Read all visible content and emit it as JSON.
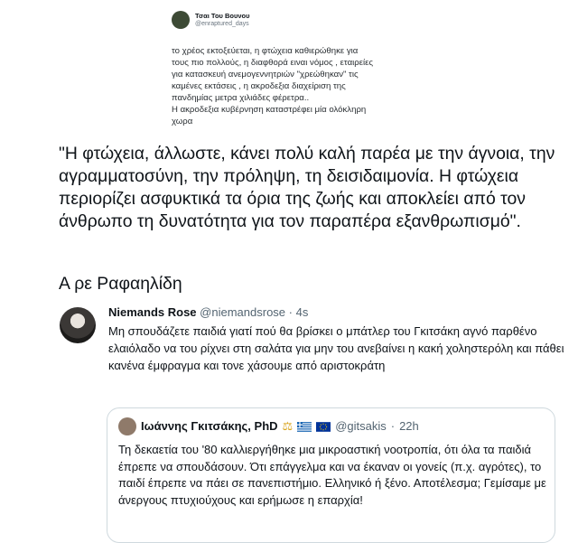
{
  "top_tweet": {
    "name": "Τσαι Του Βουνου",
    "handle": "@enraptured_days",
    "text": "το χρέος εκτοξεύεται, η φτώχεια καθιερώθηκε για\nτους πιο πολλούς, η διαφθορά ειναι νόμος , εταιρείες\nγια κατασκευή ανεμογεννητριών  \"χρεώθηκαν\" τις\nκαμένες εκτάσεις , η ακροδεξια διαχείριση της\nπανδημίας μετρα χιλιάδες φέρετρα..\nΗ ακροδεξια κυβέρνηση καταστρέφει μία ολόκληρη\nχωρα"
  },
  "quote_text": "\"Η φτώχεια, άλλωστε, κάνει πολύ καλή παρέα με την άγνοια, την αγραμματοσύνη, την πρόληψη, τη δεισιδαιμονία. Η φτώχεια περιορίζει ασφυκτικά τα όρια της ζωής και αποκλείει από τον άνθρωπο τη δυνατότητα για τον παραπέρα εξανθρωπισμό\".",
  "quote_sign": "Α ρε Ραφαηλίδη",
  "reply": {
    "name": "Niemands Rose",
    "handle": "@niemandsrose",
    "separator": "·",
    "time": "4s",
    "text": "Μη σπουδάζετε παιδιά γιατί πού θα βρίσκει ο μπάτλερ του Γκιτσάκη αγνό παρθένο ελαιόλαδο να του ρίχνει στη σαλάτα για μην του ανεβαίνει η κακή χοληστερόλη και πάθει κανένα έμφραγμα και τονε χάσουμε από αριστοκράτη"
  },
  "quoted": {
    "name": "Ιωάννης Γκιτσάκης, PhD",
    "handle": "@gitsakis",
    "separator": "·",
    "time": "22h",
    "text": "Τη δεκαετία του '80 καλλιεργήθηκε μια μικροαστική νοοτροπία, ότι όλα τα παιδιά έπρεπε να σπουδάσουν. Ότι επάγγελμα και να έκαναν οι γονείς (π.χ. αγρότες), το παιδί έπρεπε να πάει σε πανεπιστήμιο. Ελληνικό ή ξένο. Αποτέλεσμα; Γεμίσαμε με άνεργους πτυχιούχους και ερήμωσε η επαρχία!"
  },
  "colors": {
    "text": "#0f1419",
    "secondary": "#536471",
    "border": "#cfd9de",
    "greek_flag_blue": "#0d5eaf",
    "eu_blue": "#003399",
    "eu_gold": "#ffcc00"
  }
}
